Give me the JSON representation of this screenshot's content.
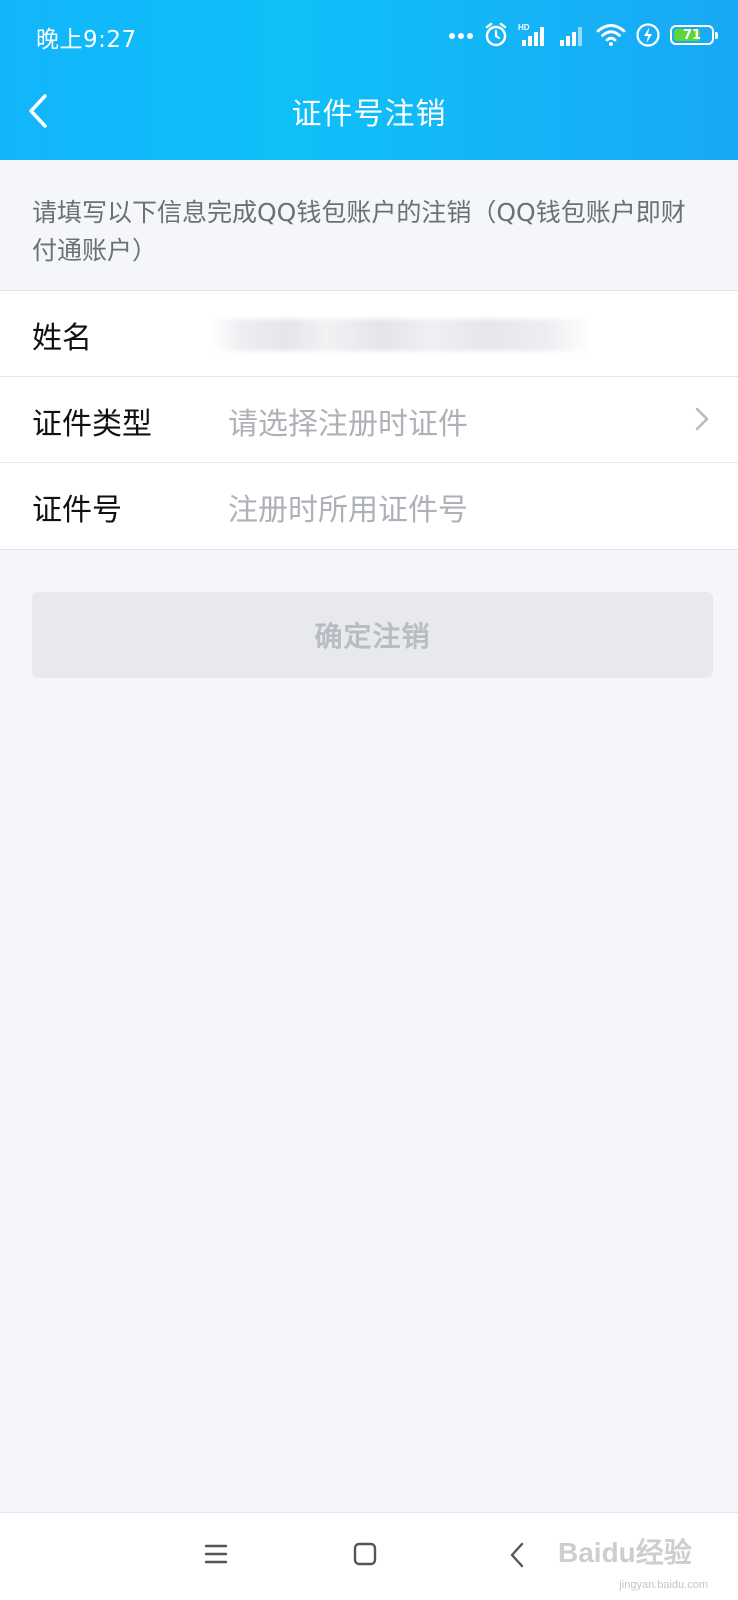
{
  "status_bar": {
    "time": "晚上9:27",
    "battery_level": "71",
    "battery_fraction": 0.71,
    "icons": [
      "more-dots-icon",
      "alarm-icon",
      "hd-signal-icon",
      "signal-icon",
      "wifi-icon",
      "charging-icon",
      "battery-icon"
    ],
    "network_badge": "HD"
  },
  "nav": {
    "title": "证件号注销",
    "back_icon": "chevron-left-icon"
  },
  "notice": {
    "text": "请填写以下信息完成QQ钱包账户的注销（QQ钱包账户即财付通账户）"
  },
  "form": {
    "rows": [
      {
        "label": "姓名",
        "value": "",
        "value_obscured": true
      },
      {
        "label": "证件类型",
        "placeholder": "请选择注册时证件",
        "has_chevron": true
      },
      {
        "label": "证件号",
        "placeholder": "注册时所用证件号"
      }
    ]
  },
  "submit": {
    "label": "确定注销",
    "enabled": false
  },
  "system_nav": {
    "buttons": [
      "menu-icon",
      "home-icon",
      "back-icon"
    ]
  },
  "watermark": {
    "text": "Baidu经验",
    "sub": "jingyan.baidu.com"
  },
  "colors": {
    "header_gradient_start": "#12b5fb",
    "header_gradient_end": "#19a8f5",
    "page_background": "#f5f6fa",
    "disabled_button": "#e8e9ec",
    "placeholder_text": "#aeb1b7"
  }
}
